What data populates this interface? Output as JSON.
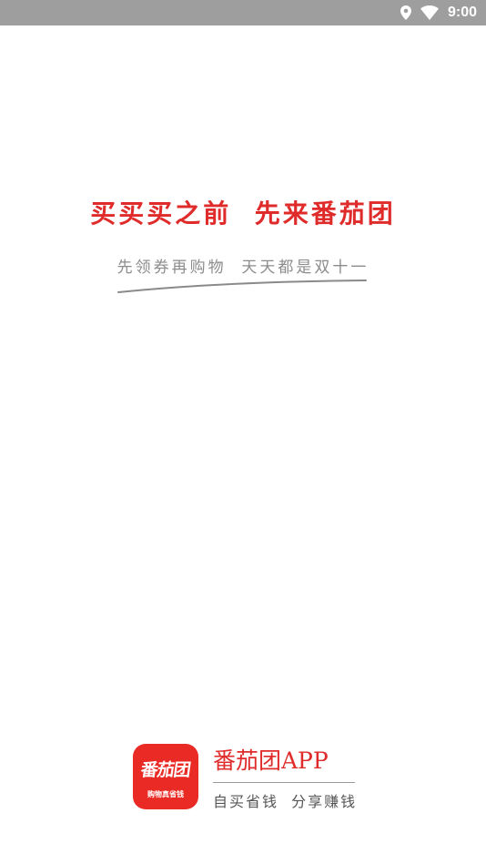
{
  "status_bar": {
    "time": "9:00",
    "icons": [
      "location-icon",
      "wifi-icon"
    ],
    "background": "#9e9e9e"
  },
  "splash": {
    "slogan": "买买买之前  先来番茄团",
    "sub_slogan": "先领券再购物  天天都是双十一",
    "accent_color": "#e02b2b"
  },
  "brand": {
    "logo_title": "番茄团",
    "logo_tagline": "购物真省钱",
    "name": "番茄团APP",
    "tagline": "自买省钱  分享赚钱"
  }
}
